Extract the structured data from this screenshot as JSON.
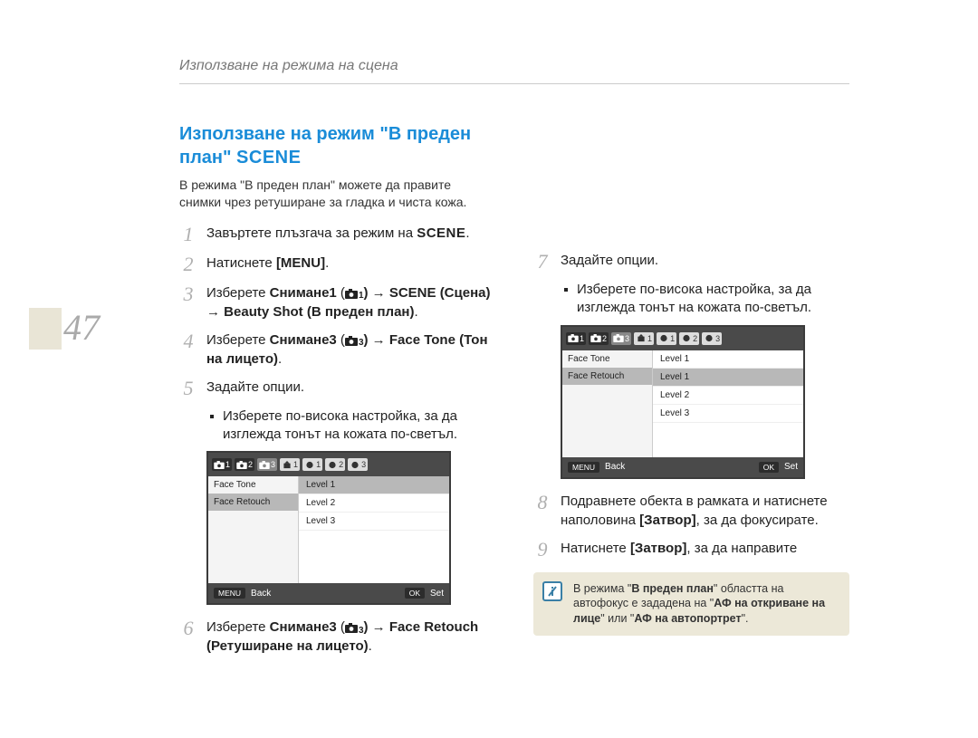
{
  "running_head": "Използване на режима на сцена",
  "page_number": "47",
  "headline_part1": "Използване на режим \"В преден план\" ",
  "headline_scene": "SCENE",
  "intro": "В режима \"В преден план\" можете да правите снимки чрез ретуширане за гладка и чиста кожа.",
  "steps_left": [
    {
      "n": "1",
      "pre": "Завъртете плъзгача за режим на ",
      "scene": "SCENE",
      "post": "."
    },
    {
      "n": "2",
      "pre": "Натиснете ",
      "bold": "[MENU]",
      "post": "."
    },
    {
      "n": "3",
      "pre": "Изберете ",
      "bold1": "Снимане1",
      "camera_sub": "1",
      "mid": ") → ",
      "bold2": "SCENE (Сцена)",
      "mid2": " → ",
      "bold3": "Beauty Shot (В преден план)",
      "post": "."
    },
    {
      "n": "4",
      "pre": "Изберете ",
      "bold1": "Снимане3",
      "camera_sub": "3",
      "mid": ") → ",
      "bold2": "Face Tone (Тон на лицето)",
      "post": "."
    },
    {
      "n": "5",
      "text": "Задайте опции."
    }
  ],
  "sub_bullet": "Изберете по-висока настройка, за да изглежда тонът на кожата по-светъл.",
  "step6": {
    "n": "6",
    "pre": "Изберете ",
    "bold1": "Снимане3",
    "camera_sub": "3",
    "mid": ") → ",
    "bold2": "Face Retouch (Ретуширане на лицето)",
    "post": "."
  },
  "steps_right": [
    {
      "n": "7",
      "text": "Задайте опции."
    },
    {
      "n": "8",
      "pre": "Подравнете обекта в рамката и натиснете наполовина ",
      "bold": "[Затвор]",
      "post": ", за да фокусирате."
    },
    {
      "n": "9",
      "pre": "Натиснете ",
      "bold": "[Затвор]",
      "post": ", за да направите"
    }
  ],
  "menu1": {
    "tabs": [
      "1",
      "2",
      "3",
      "1",
      "1",
      "2",
      "3"
    ],
    "active_tab_index": 2,
    "left": [
      "Face Tone",
      "Face Retouch"
    ],
    "left_selected_index": 1,
    "right": [
      "Level 1",
      "Level 2",
      "Level 3"
    ],
    "right_selected_index": 0,
    "footer_menu_btn": "MENU",
    "footer_back": "Back",
    "footer_ok_btn": "OK",
    "footer_set": "Set"
  },
  "menu2": {
    "tabs": [
      "1",
      "2",
      "3",
      "1",
      "1",
      "2",
      "3"
    ],
    "active_tab_index": 2,
    "left": [
      "Face Tone",
      "Face Retouch"
    ],
    "left_selected_index": 1,
    "right": [
      "Level 1",
      "Level 1",
      "Level 2",
      "Level 3"
    ],
    "right_top_value": "Level 1",
    "right_selected_index": 1,
    "footer_menu_btn": "MENU",
    "footer_back": "Back",
    "footer_ok_btn": "OK",
    "footer_set": "Set"
  },
  "note": {
    "pre": "В режима \"",
    "bold1": "В преден план",
    "mid1": "\" областта на автофокус е зададена на \"",
    "bold2": "АФ на откриване на лице",
    "mid2": "\" или \"",
    "bold3": "АФ на автопортрет",
    "post": "\"."
  }
}
